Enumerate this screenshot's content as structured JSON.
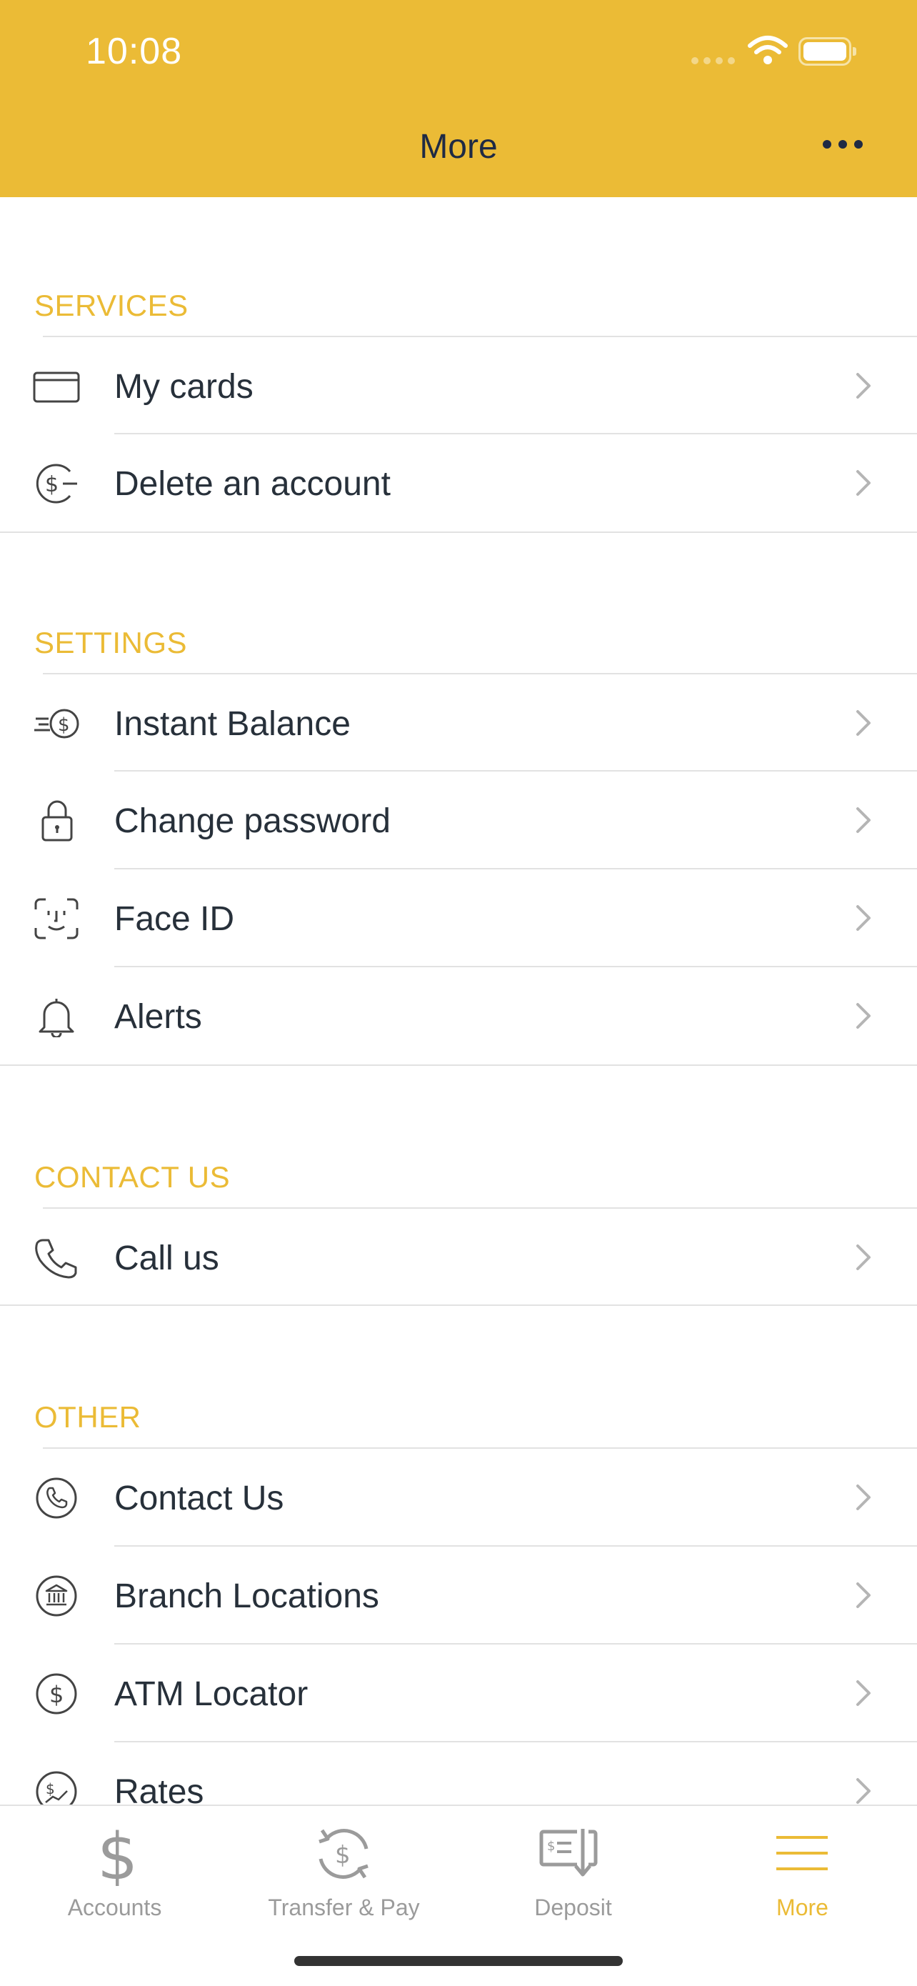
{
  "status_bar": {
    "time": "10:08"
  },
  "header": {
    "title": "More"
  },
  "sections": [
    {
      "title": "SERVICES",
      "items": [
        {
          "label": "My cards",
          "icon": "card-icon"
        },
        {
          "label": "Delete an account",
          "icon": "dollar-minus-icon"
        }
      ]
    },
    {
      "title": "SETTINGS",
      "items": [
        {
          "label": "Instant Balance",
          "icon": "fast-dollar-icon"
        },
        {
          "label": "Change password",
          "icon": "lock-icon"
        },
        {
          "label": "Face ID",
          "icon": "face-id-icon"
        },
        {
          "label": "Alerts",
          "icon": "bell-icon"
        }
      ]
    },
    {
      "title": "CONTACT US",
      "items": [
        {
          "label": "Call us",
          "icon": "phone-icon"
        }
      ]
    },
    {
      "title": "OTHER",
      "items": [
        {
          "label": "Contact Us",
          "icon": "phone-circle-icon"
        },
        {
          "label": "Branch Locations",
          "icon": "bank-icon"
        },
        {
          "label": "ATM Locator",
          "icon": "dollar-circle-icon"
        },
        {
          "label": "Rates",
          "icon": "rates-icon"
        }
      ]
    }
  ],
  "tabbar": {
    "tabs": [
      {
        "label": "Accounts",
        "icon": "dollar-icon"
      },
      {
        "label": "Transfer & Pay",
        "icon": "transfer-icon"
      },
      {
        "label": "Deposit",
        "icon": "check-deposit-icon"
      },
      {
        "label": "More",
        "icon": "menu-icon"
      }
    ],
    "active": "More"
  },
  "colors": {
    "accent": "#EBBB36",
    "text": "#27303a",
    "inactive": "#9b9b9b"
  }
}
